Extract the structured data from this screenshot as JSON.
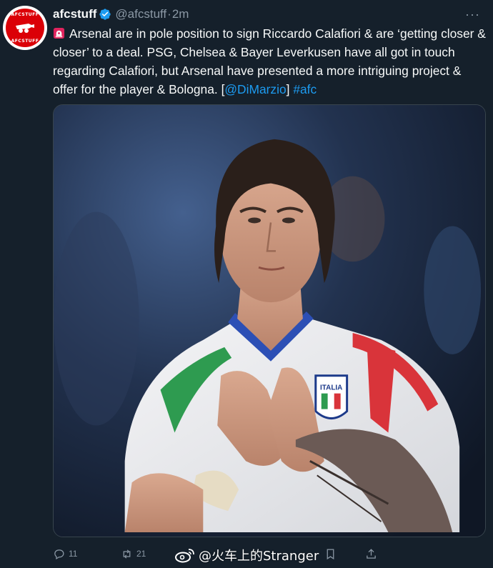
{
  "tweet": {
    "avatar": {
      "top_text": "AFCSTUFF",
      "bottom_text": "AFCSTUFF",
      "color": "#db0007"
    },
    "display_name": "afcstuff",
    "handle": "@afcstuff",
    "separator": "·",
    "time": "2m",
    "more_icon": "more-horizontal-icon",
    "more_label": "···",
    "text": {
      "emoji": "rotating-light-emoji",
      "body": "Arsenal are in pole position to sign Riccardo Calafiori & are ‘getting closer & closer’ to a deal. PSG, Chelsea & Bayer Leverkusen have all got in touch regarding Calafiori, but Arsenal have presented a more intriguing project & offer for the player & Bologna. [",
      "mention": "@DiMarzio",
      "bracket_close": "] ",
      "hashtag": "#afc"
    },
    "media": {
      "description_hidden": true,
      "badge_text": "ITALIA"
    },
    "actions": {
      "reply_count": "11",
      "retweet_count": "21"
    },
    "watermark": "@火车上的Stranger",
    "colors": {
      "background": "#15202b",
      "link": "#1d9bf0",
      "muted": "#8b98a5",
      "verified": "#1d9bf0"
    }
  }
}
